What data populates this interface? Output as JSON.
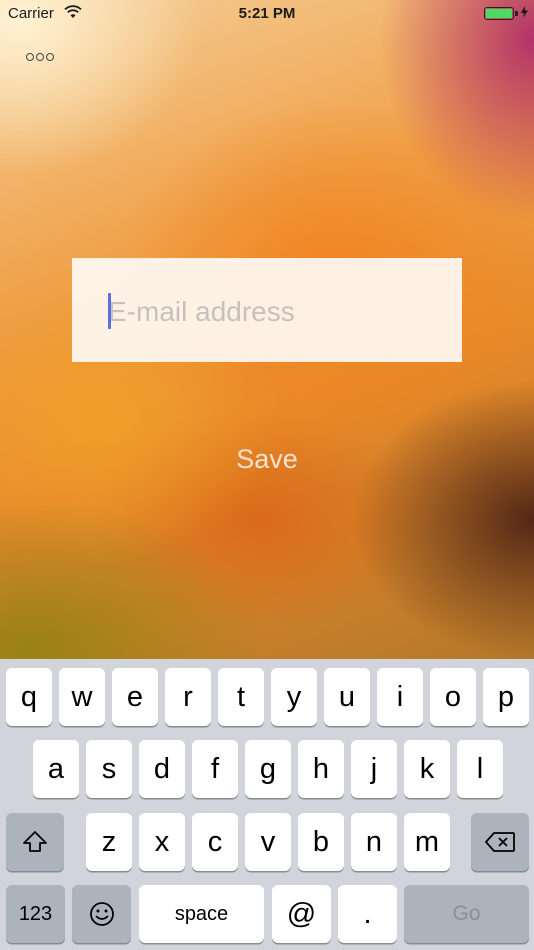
{
  "status_bar": {
    "carrier": "Carrier",
    "time": "5:21 PM",
    "wifi_icon": "wifi-icon",
    "battery_icon": "battery-icon",
    "charging_icon": "charging-bolt-icon",
    "battery_level": 1.0
  },
  "toolbar": {
    "more_icon": "more-options-icon"
  },
  "form": {
    "email_placeholder": "E-mail address",
    "email_value": "",
    "save_label": "Save"
  },
  "keyboard": {
    "row1": [
      "q",
      "w",
      "e",
      "r",
      "t",
      "y",
      "u",
      "i",
      "o",
      "p"
    ],
    "row2": [
      "a",
      "s",
      "d",
      "f",
      "g",
      "h",
      "j",
      "k",
      "l"
    ],
    "row3": [
      "z",
      "x",
      "c",
      "v",
      "b",
      "n",
      "m"
    ],
    "shift_icon": "shift-icon",
    "delete_icon": "backspace-icon",
    "numbers_label": "123",
    "emoji_icon": "emoji-icon",
    "space_label": "space",
    "at_label": "@",
    "dot_label": ".",
    "go_label": "Go"
  },
  "colors": {
    "cursor": "#5b6fe0",
    "battery": "#4cd964",
    "keyboard_bg": "#d1d5db",
    "key_dark": "#acb3bd"
  }
}
